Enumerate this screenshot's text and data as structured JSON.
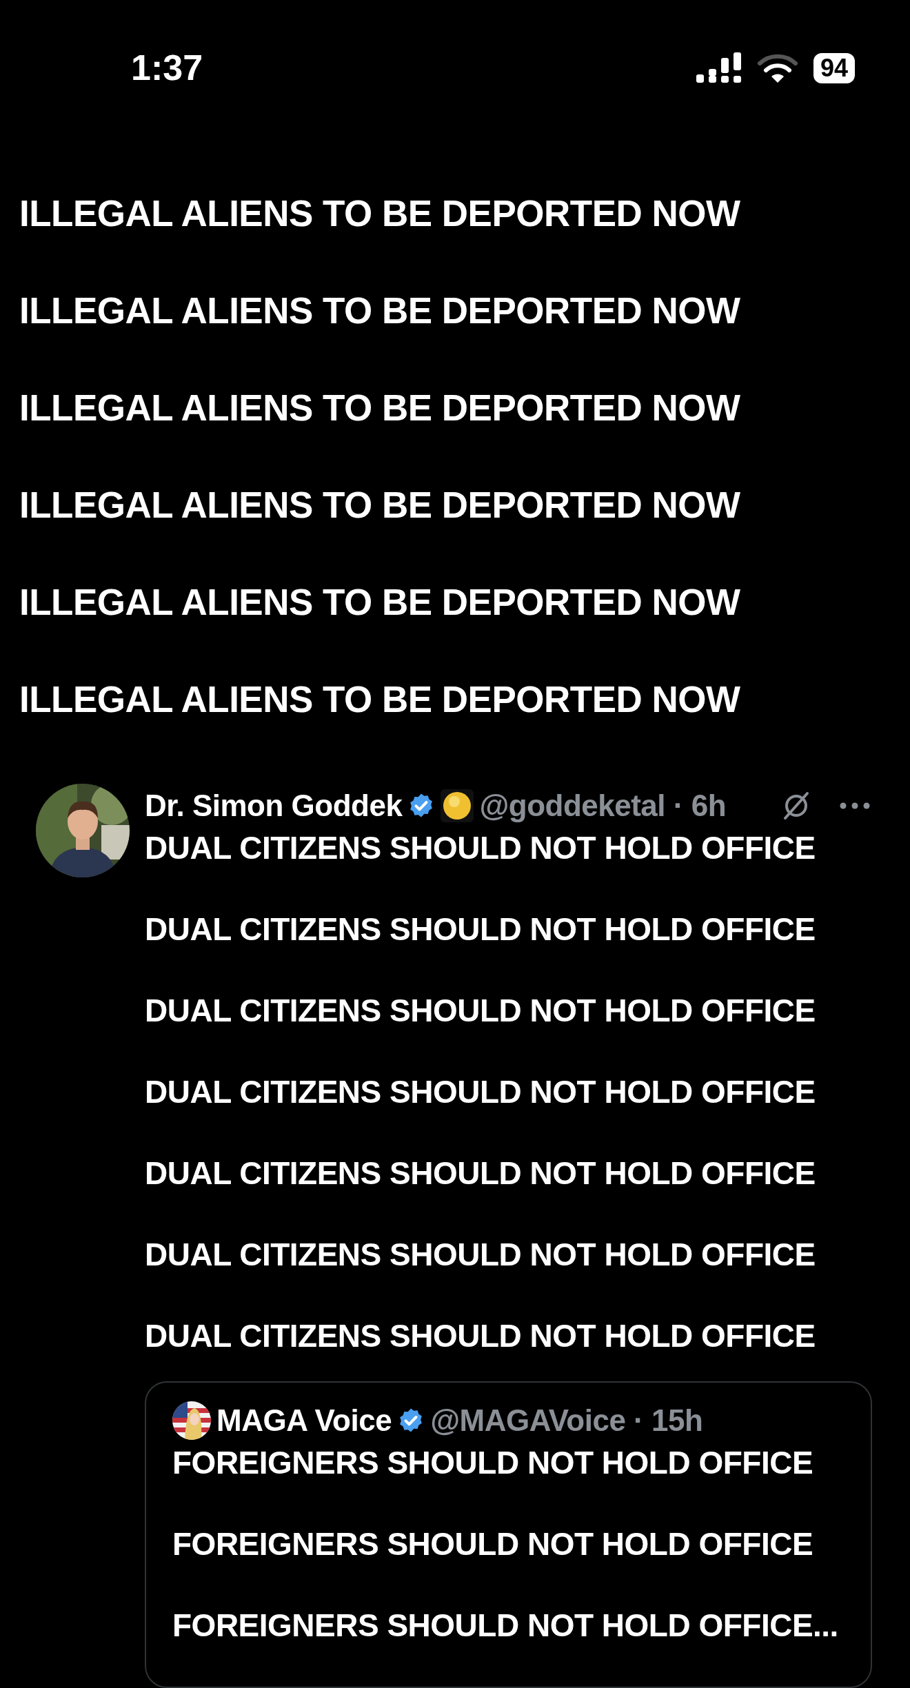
{
  "status_bar": {
    "time": "1:37",
    "battery": "94"
  },
  "post": {
    "lines": [
      "ILLEGAL ALIENS TO BE DEPORTED NOW",
      "ILLEGAL ALIENS TO BE DEPORTED NOW",
      "ILLEGAL ALIENS TO BE DEPORTED NOW",
      "ILLEGAL ALIENS TO BE DEPORTED NOW",
      "ILLEGAL ALIENS TO BE DEPORTED NOW",
      "ILLEGAL ALIENS TO BE DEPORTED NOW"
    ]
  },
  "reply": {
    "author": "Dr. Simon Goddek",
    "verified": true,
    "meta": "@goddeketal · 6h",
    "lines": [
      "DUAL CITIZENS SHOULD NOT HOLD OFFICE",
      "DUAL CITIZENS SHOULD NOT HOLD OFFICE",
      "DUAL CITIZENS SHOULD NOT HOLD OFFICE",
      "DUAL CITIZENS SHOULD NOT HOLD OFFICE",
      "DUAL CITIZENS SHOULD NOT HOLD OFFICE",
      "DUAL CITIZENS SHOULD NOT HOLD OFFICE",
      "DUAL CITIZENS SHOULD NOT HOLD OFFICE"
    ],
    "quote": {
      "author": "MAGA Voice",
      "verified": true,
      "meta": "@MAGAVoice · 15h",
      "lines": [
        "FOREIGNERS SHOULD NOT HOLD OFFICE",
        "FOREIGNERS SHOULD NOT HOLD OFFICE",
        "FOREIGNERS SHOULD NOT HOLD OFFICE..."
      ]
    }
  }
}
